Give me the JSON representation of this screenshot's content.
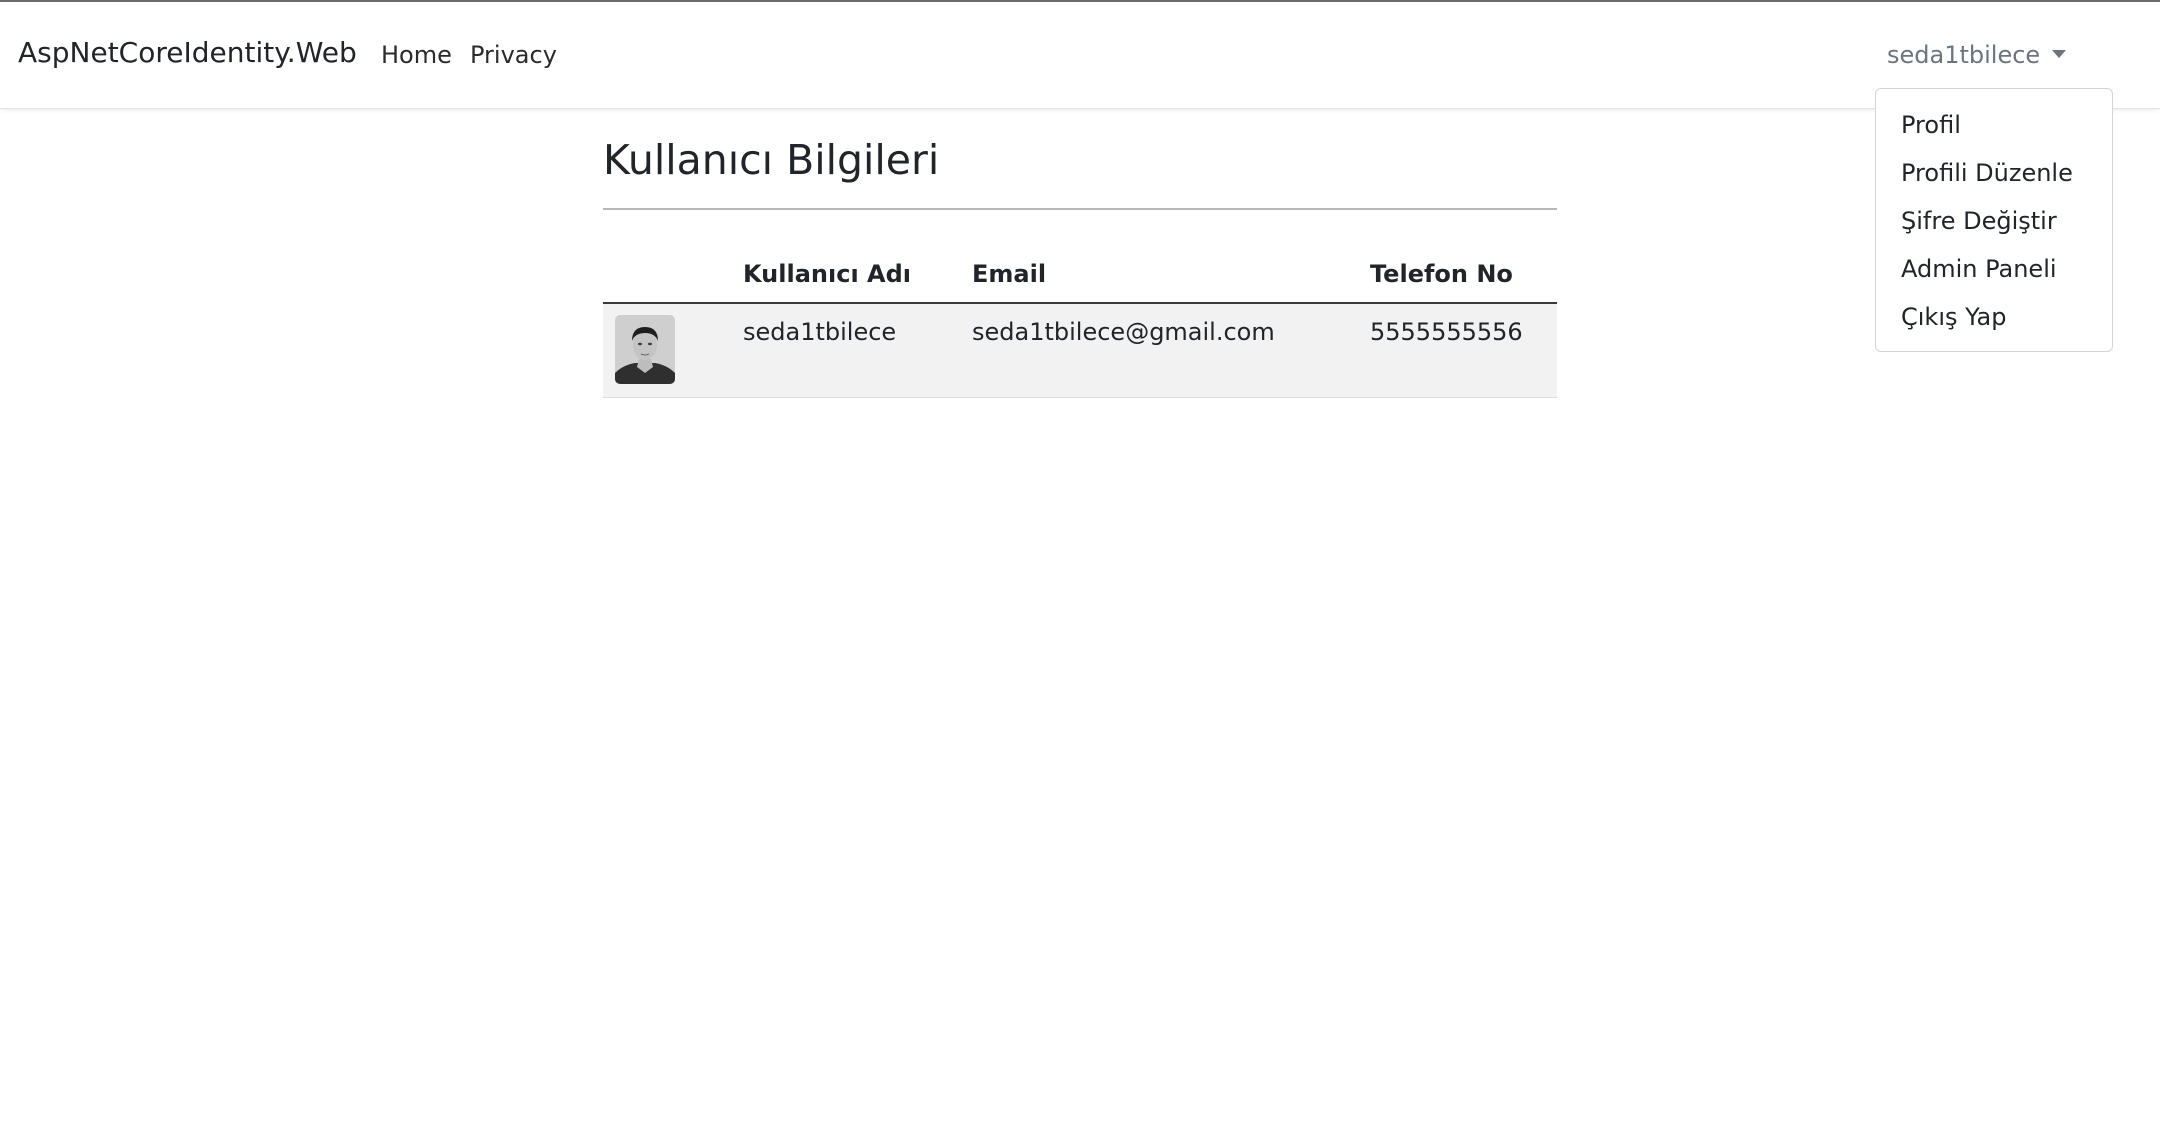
{
  "navbar": {
    "brand": "AspNetCoreIdentity.Web",
    "links": [
      {
        "label": "Home"
      },
      {
        "label": "Privacy"
      }
    ],
    "user_menu": {
      "username": "seda1tbilece",
      "items": [
        {
          "label": "Profil"
        },
        {
          "label": "Profili Düzenle"
        },
        {
          "label": "Şifre Değiştir"
        },
        {
          "label": "Admin Paneli"
        },
        {
          "label": "Çıkış Yap"
        }
      ]
    }
  },
  "main": {
    "title": "Kullanıcı Bilgileri",
    "table": {
      "headers": [
        "",
        "Kullanıcı Adı",
        "Email",
        "Telefon No"
      ],
      "rows": [
        {
          "username": "seda1tbilece",
          "email": "seda1tbilece@gmail.com",
          "phone": "5555555556"
        }
      ]
    }
  },
  "colors": {
    "text": "#212529",
    "muted": "#6c757d",
    "row_bg": "#f2f2f2",
    "border": "#d5d5d5"
  },
  "icons": {
    "avatar": "user-profile-photo",
    "caret": "caret-down-icon"
  }
}
